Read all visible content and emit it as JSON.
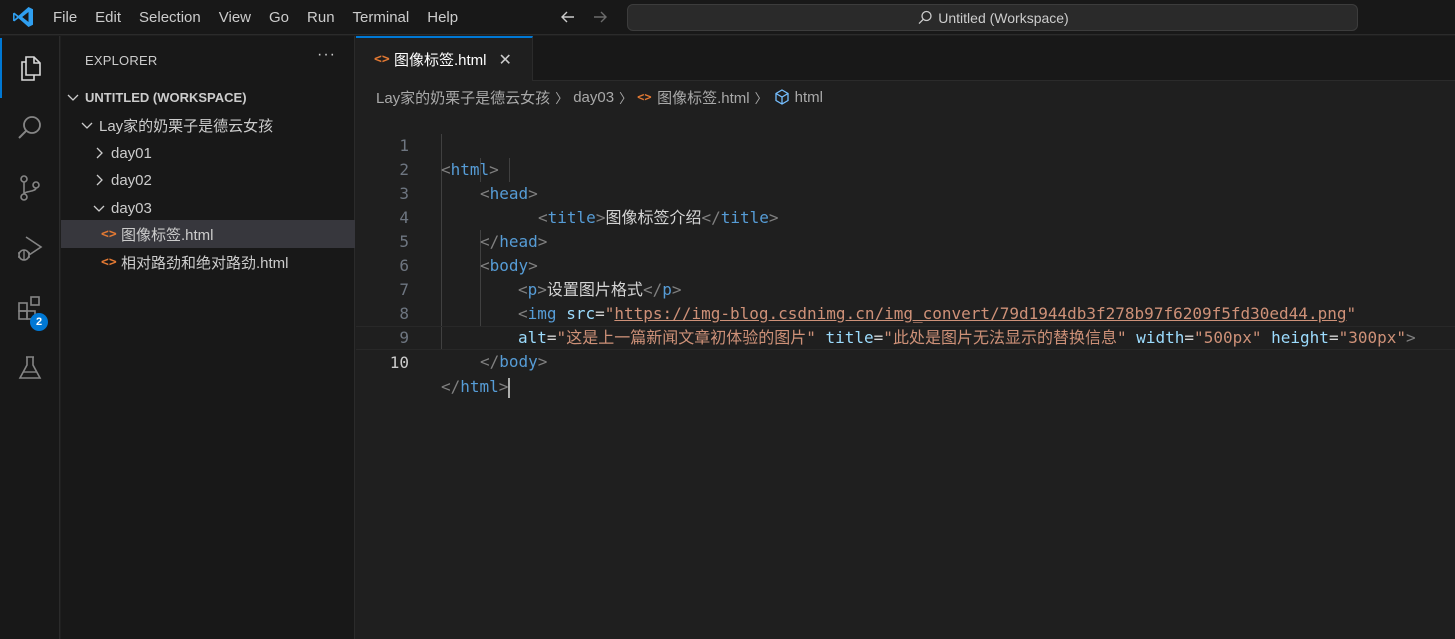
{
  "titlebar": {
    "menu": [
      "File",
      "Edit",
      "Selection",
      "View",
      "Go",
      "Run",
      "Terminal",
      "Help"
    ],
    "search_text": "Untitled (Workspace)"
  },
  "activitybar": {
    "items": [
      "explorer-icon",
      "search-icon",
      "source-control-icon",
      "run-debug-icon",
      "extensions-icon",
      "testing-icon"
    ],
    "extensions_badge": "2"
  },
  "sidebar": {
    "title": "EXPLORER",
    "more": "···",
    "workspace": "UNTITLED (WORKSPACE)",
    "folder": "Lay家的奶栗子是德云女孩",
    "subfolders": [
      "day01",
      "day02",
      "day03"
    ],
    "files": [
      "图像标签.html",
      "相对路劲和绝对路劲.html"
    ]
  },
  "editor": {
    "tab_label": "图像标签.html",
    "breadcrumbs": {
      "folder": "Lay家的奶栗子是德云女孩",
      "subfolder": "day03",
      "file": "图像标签.html",
      "symbol": "html"
    },
    "line_numbers": [
      "1",
      "2",
      "3",
      "4",
      "5",
      "6",
      "7",
      "8",
      "9",
      "10"
    ],
    "code": {
      "html_tag": "html",
      "head_tag": "head",
      "title_tag": "title",
      "title_text": "图像标签介绍",
      "body_tag": "body",
      "p_tag": "p",
      "p_text": "设置图片格式",
      "img_tag": "img",
      "src_attr": "src",
      "src_value": "https://img-blog.csdnimg.cn/img_convert/79d1944db3f278b97f6209f5fd30ed44.png",
      "alt_attr": "alt",
      "alt_value": "这是上一篇新闻文章初体验的图片",
      "title_attr": "title",
      "title_value": "此处是图片无法显示的替换信息",
      "width_attr": "width",
      "width_value": "500px",
      "height_attr": "height",
      "height_value": "300px"
    }
  }
}
